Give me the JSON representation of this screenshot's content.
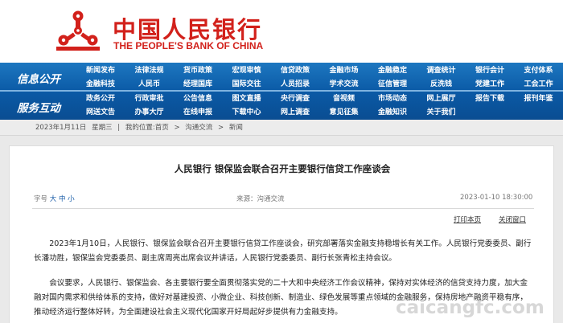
{
  "header": {
    "brand_cn": "中国人民银行",
    "brand_en": "THE PEOPLE'S BANK OF CHINA",
    "brand_color": "#d2211b"
  },
  "nav": {
    "section_info": "信息公开",
    "section_service": "服务互动",
    "info_row1": [
      "新闻发布",
      "法律法规",
      "货币政策",
      "宏观审慎",
      "信贷政策",
      "金融市场",
      "金融稳定",
      "调查统计",
      "银行会计",
      "支付体系"
    ],
    "info_row2": [
      "金融科技",
      "人民币",
      "经理国库",
      "国际交往",
      "人员招录",
      "学术交流",
      "征信管理",
      "反洗钱",
      "党建工作",
      "工会工作"
    ],
    "service_row1": [
      "政务公开",
      "行政审批",
      "公告信息",
      "图文直播",
      "央行调查",
      "音视频",
      "市场动态",
      "网上展厅",
      "报告下载",
      "报刊年鉴"
    ],
    "service_row2": [
      "网送文告",
      "办事大厅",
      "在线申报",
      "下载中心",
      "网上调查",
      "意见征集",
      "金融知识",
      "关于我们",
      "",
      ""
    ],
    "bg_color": "#0b5aa6"
  },
  "breadcrumb": {
    "date": "2023年1月11日",
    "weekday": "星期三",
    "location_label": "我的位置:",
    "home": "首页",
    "sep": ">",
    "level1": "沟通交流",
    "level2": "新闻"
  },
  "article": {
    "title": "人民银行 银保监会联合召开主要银行信贷工作座谈会",
    "font_size_label": "字号",
    "font_sizes": [
      "大",
      "中",
      "小"
    ],
    "source_label": "来源：",
    "source": "沟通交流",
    "datetime": "2023-01-10 18:30:00",
    "print_label": "打印本页",
    "close_label": "关闭窗口",
    "paragraphs": [
      "2023年1月10日，人民银行、银保监会联合召开主要银行信贷工作座谈会，研究部署落实金融支持稳增长有关工作。人民银行党委委员、副行长潘功胜，银保监会党委委员、副主席周亮出席会议并讲话，人民银行党委委员、副行长张青松主持会议。",
      "会议要求，人民银行、银保监会、各主要银行要全面贯彻落实党的二十大和中央经济工作会议精神，保持对实体经济的信贷支持力度，加大金融对国内需求和供给体系的支持，做好对基建投资、小微企业、科技创新、制造业、绿色发展等重点领域的金融服务，保持房地产融资平稳有序，推动经济运行整体好转，为全面建设社会主义现代化国家开好局起好步提供有力金融支持。"
    ]
  },
  "watermark": "caicangfc.com"
}
